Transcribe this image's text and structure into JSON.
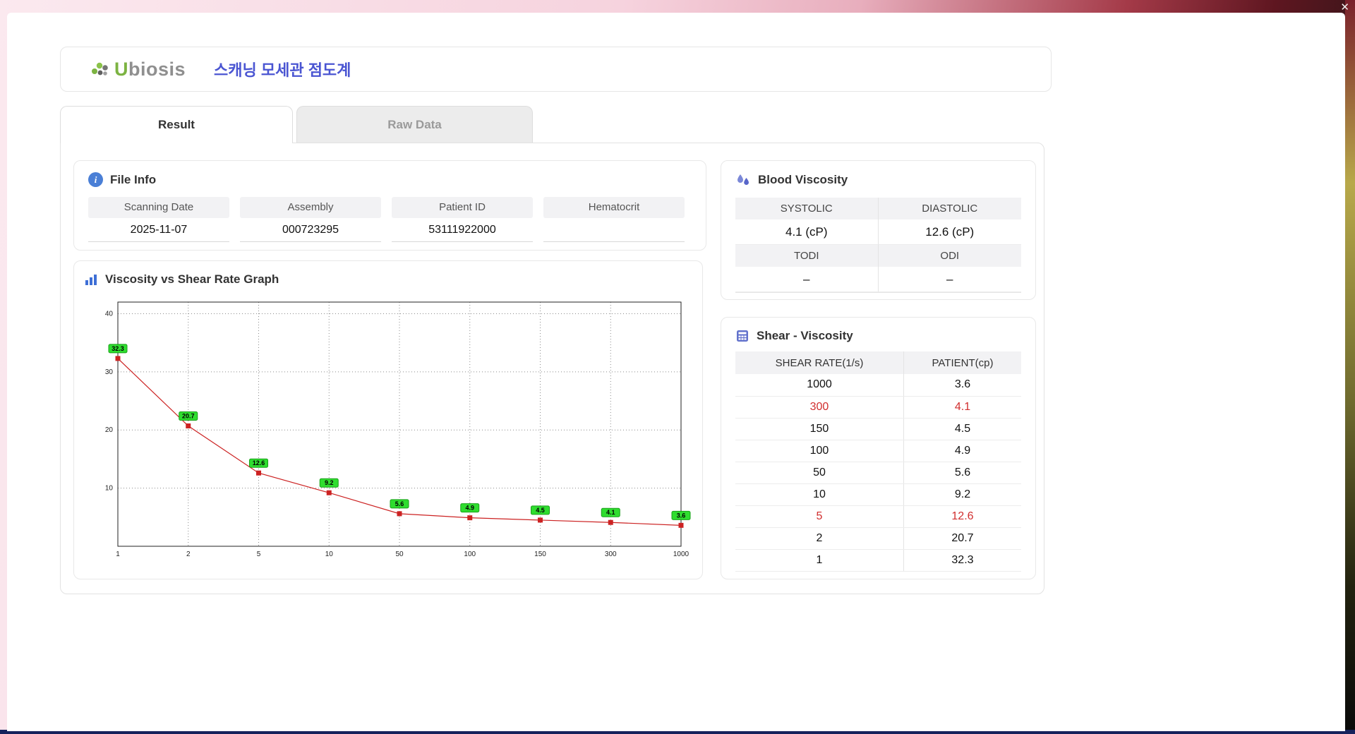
{
  "window": {
    "close": "✕"
  },
  "header": {
    "logo_u": "U",
    "logo_rest": "biosis",
    "title": "스캐닝 모세관 점도계"
  },
  "tabs": [
    {
      "label": "Result",
      "active": true
    },
    {
      "label": "Raw Data",
      "active": false
    }
  ],
  "file_info": {
    "title": "File Info",
    "fields": [
      {
        "label": "Scanning Date",
        "value": "2025-11-07"
      },
      {
        "label": "Assembly",
        "value": "000723295"
      },
      {
        "label": "Patient ID",
        "value": "53111922000"
      },
      {
        "label": "Hematocrit",
        "value": ""
      }
    ]
  },
  "graph": {
    "title": "Viscosity vs Shear Rate Graph"
  },
  "blood_viscosity": {
    "title": "Blood Viscosity",
    "rows": [
      {
        "labels": [
          "SYSTOLIC",
          "DIASTOLIC"
        ],
        "values": [
          "4.1 (cP)",
          "12.6 (cP)"
        ]
      },
      {
        "labels": [
          "TODI",
          "ODI"
        ],
        "values": [
          "–",
          "–"
        ]
      }
    ]
  },
  "shear_viscosity": {
    "title": "Shear - Viscosity",
    "columns": [
      "SHEAR RATE(1/s)",
      "PATIENT(cp)"
    ],
    "rows": [
      {
        "rate": "1000",
        "patient": "3.6",
        "highlight": false
      },
      {
        "rate": "300",
        "patient": "4.1",
        "highlight": true
      },
      {
        "rate": "150",
        "patient": "4.5",
        "highlight": false
      },
      {
        "rate": "100",
        "patient": "4.9",
        "highlight": false
      },
      {
        "rate": "50",
        "patient": "5.6",
        "highlight": false
      },
      {
        "rate": "10",
        "patient": "9.2",
        "highlight": false
      },
      {
        "rate": "5",
        "patient": "12.6",
        "highlight": true
      },
      {
        "rate": "2",
        "patient": "20.7",
        "highlight": false
      },
      {
        "rate": "1",
        "patient": "32.3",
        "highlight": false
      }
    ]
  },
  "chart_data": {
    "type": "line",
    "title": "Viscosity vs Shear Rate Graph",
    "x": [
      1,
      2,
      5,
      10,
      50,
      100,
      150,
      300,
      1000
    ],
    "values": [
      32.3,
      20.7,
      12.6,
      9.2,
      5.6,
      4.9,
      4.5,
      4.1,
      3.6
    ],
    "xlabel": "",
    "ylabel": "",
    "yticks": [
      10,
      20,
      30,
      40
    ],
    "ylim": [
      0,
      42
    ],
    "x_spacing": "equal-categorical",
    "grid": "dotted",
    "legend": "none",
    "line_color": "#cc2222",
    "marker": "square",
    "marker_color": "#cc2222",
    "label_bg": "#2fdd2f",
    "label_border": "#18a018"
  },
  "colors": {
    "title_accent": "#4a55d2",
    "highlight_red": "#d12e2e",
    "label_green": "#2fdd2f",
    "logo_green": "#7cb342"
  }
}
